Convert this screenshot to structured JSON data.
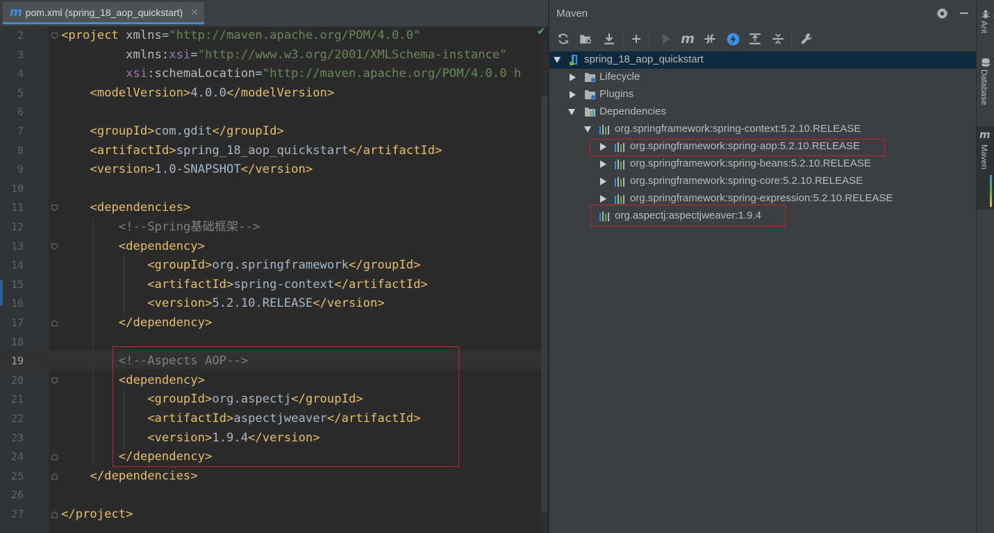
{
  "editor": {
    "tab": {
      "icon": "maven-m-icon",
      "title": "pom.xml (spring_18_aop_quickstart)",
      "close": "×"
    },
    "lines": [
      {
        "n": "2",
        "tokens": [
          [
            "tag",
            "<project "
          ],
          [
            "attr",
            "xmlns"
          ],
          [
            "txt",
            "="
          ],
          [
            "val",
            "\"http://maven.apache.org/POM/4.0.0\""
          ]
        ]
      },
      {
        "n": "3",
        "tokens": [
          [
            "txt",
            "         "
          ],
          [
            "attr",
            "xmlns:"
          ],
          [
            "ns",
            "xsi"
          ],
          [
            "txt",
            "="
          ],
          [
            "val",
            "\"http://www.w3.org/2001/XMLSchema-instance\""
          ]
        ]
      },
      {
        "n": "4",
        "tokens": [
          [
            "txt",
            "         "
          ],
          [
            "ns",
            "xsi"
          ],
          [
            "attr",
            ":schemaLocation"
          ],
          [
            "txt",
            "="
          ],
          [
            "val",
            "\"http://maven.apache.org/POM/4.0.0 h"
          ]
        ]
      },
      {
        "n": "5",
        "tokens": [
          [
            "txt",
            "    "
          ],
          [
            "tag",
            "<modelVersion>"
          ],
          [
            "txt",
            "4.0.0"
          ],
          [
            "tag",
            "</modelVersion>"
          ]
        ]
      },
      {
        "n": "6",
        "tokens": []
      },
      {
        "n": "7",
        "tokens": [
          [
            "txt",
            "    "
          ],
          [
            "tag",
            "<groupId>"
          ],
          [
            "txt",
            "com.gdit"
          ],
          [
            "tag",
            "</groupId>"
          ]
        ]
      },
      {
        "n": "8",
        "tokens": [
          [
            "txt",
            "    "
          ],
          [
            "tag",
            "<artifactId>"
          ],
          [
            "txt",
            "spring_18_aop_quickstart"
          ],
          [
            "tag",
            "</artifactId>"
          ]
        ]
      },
      {
        "n": "9",
        "tokens": [
          [
            "txt",
            "    "
          ],
          [
            "tag",
            "<version>"
          ],
          [
            "txt",
            "1.0-SNAPSHOT"
          ],
          [
            "tag",
            "</version>"
          ]
        ]
      },
      {
        "n": "10",
        "tokens": []
      },
      {
        "n": "11",
        "tokens": [
          [
            "txt",
            "    "
          ],
          [
            "tag",
            "<dependencies>"
          ]
        ]
      },
      {
        "n": "12",
        "tokens": [
          [
            "txt",
            "        "
          ],
          [
            "cmt",
            "<!--Spring基础框架-->"
          ]
        ]
      },
      {
        "n": "13",
        "tokens": [
          [
            "txt",
            "        "
          ],
          [
            "tag",
            "<dependency>"
          ]
        ]
      },
      {
        "n": "14",
        "tokens": [
          [
            "txt",
            "            "
          ],
          [
            "tag",
            "<groupId>"
          ],
          [
            "txt",
            "org.springframework"
          ],
          [
            "tag",
            "</groupId>"
          ]
        ]
      },
      {
        "n": "15",
        "tokens": [
          [
            "txt",
            "            "
          ],
          [
            "tag",
            "<artifactId>"
          ],
          [
            "txt",
            "spring-context"
          ],
          [
            "tag",
            "</artifactId>"
          ]
        ]
      },
      {
        "n": "16",
        "tokens": [
          [
            "txt",
            "            "
          ],
          [
            "tag",
            "<version>"
          ],
          [
            "txt",
            "5.2.10.RELEASE"
          ],
          [
            "tag",
            "</version>"
          ]
        ]
      },
      {
        "n": "17",
        "tokens": [
          [
            "txt",
            "        "
          ],
          [
            "tag",
            "</dependency>"
          ]
        ]
      },
      {
        "n": "18",
        "tokens": []
      },
      {
        "n": "19",
        "tokens": [
          [
            "txt",
            "        "
          ],
          [
            "cmt",
            "<!--Aspects AOP-->"
          ]
        ]
      },
      {
        "n": "20",
        "tokens": [
          [
            "txt",
            "        "
          ],
          [
            "tag",
            "<dependency>"
          ]
        ]
      },
      {
        "n": "21",
        "tokens": [
          [
            "txt",
            "            "
          ],
          [
            "tag",
            "<groupId>"
          ],
          [
            "txt",
            "org.aspectj"
          ],
          [
            "tag",
            "</groupId>"
          ]
        ]
      },
      {
        "n": "22",
        "tokens": [
          [
            "txt",
            "            "
          ],
          [
            "tag",
            "<artifactId>"
          ],
          [
            "txt",
            "aspectjweaver"
          ],
          [
            "tag",
            "</artifactId>"
          ]
        ]
      },
      {
        "n": "23",
        "tokens": [
          [
            "txt",
            "            "
          ],
          [
            "tag",
            "<version>"
          ],
          [
            "txt",
            "1.9.4"
          ],
          [
            "tag",
            "</version>"
          ]
        ]
      },
      {
        "n": "24",
        "tokens": [
          [
            "txt",
            "        "
          ],
          [
            "tag",
            "</dependency>"
          ]
        ]
      },
      {
        "n": "25",
        "tokens": [
          [
            "txt",
            "    "
          ],
          [
            "tag",
            "</dependencies>"
          ]
        ]
      },
      {
        "n": "26",
        "tokens": []
      },
      {
        "n": "27",
        "tokens": [
          [
            "tag",
            "</project>"
          ]
        ]
      }
    ]
  },
  "maven": {
    "title": "Maven",
    "tree": {
      "project": "spring_18_aop_quickstart",
      "lifecycle": "Lifecycle",
      "plugins": "Plugins",
      "dependencies": "Dependencies",
      "spring_context": "org.springframework:spring-context:5.2.10.RELEASE",
      "spring_aop": "org.springframework:spring-aop:5.2.10.RELEASE",
      "spring_beans": "org.springframework:spring-beans:5.2.10.RELEASE",
      "spring_core": "org.springframework:spring-core:5.2.10.RELEASE",
      "spring_expression": "org.springframework:spring-expression:5.2.10.RELEASE",
      "aspectjweaver": "org.aspectj:aspectjweaver:1.9.4"
    }
  },
  "right_strip": {
    "ant": "Ant",
    "database": "Database",
    "maven": "Maven"
  },
  "colors": {
    "highlight_box": "#c8232b",
    "selection": "#0d293e",
    "maven_blue": "#3d8fe0",
    "dependency_green": "#62b543"
  }
}
